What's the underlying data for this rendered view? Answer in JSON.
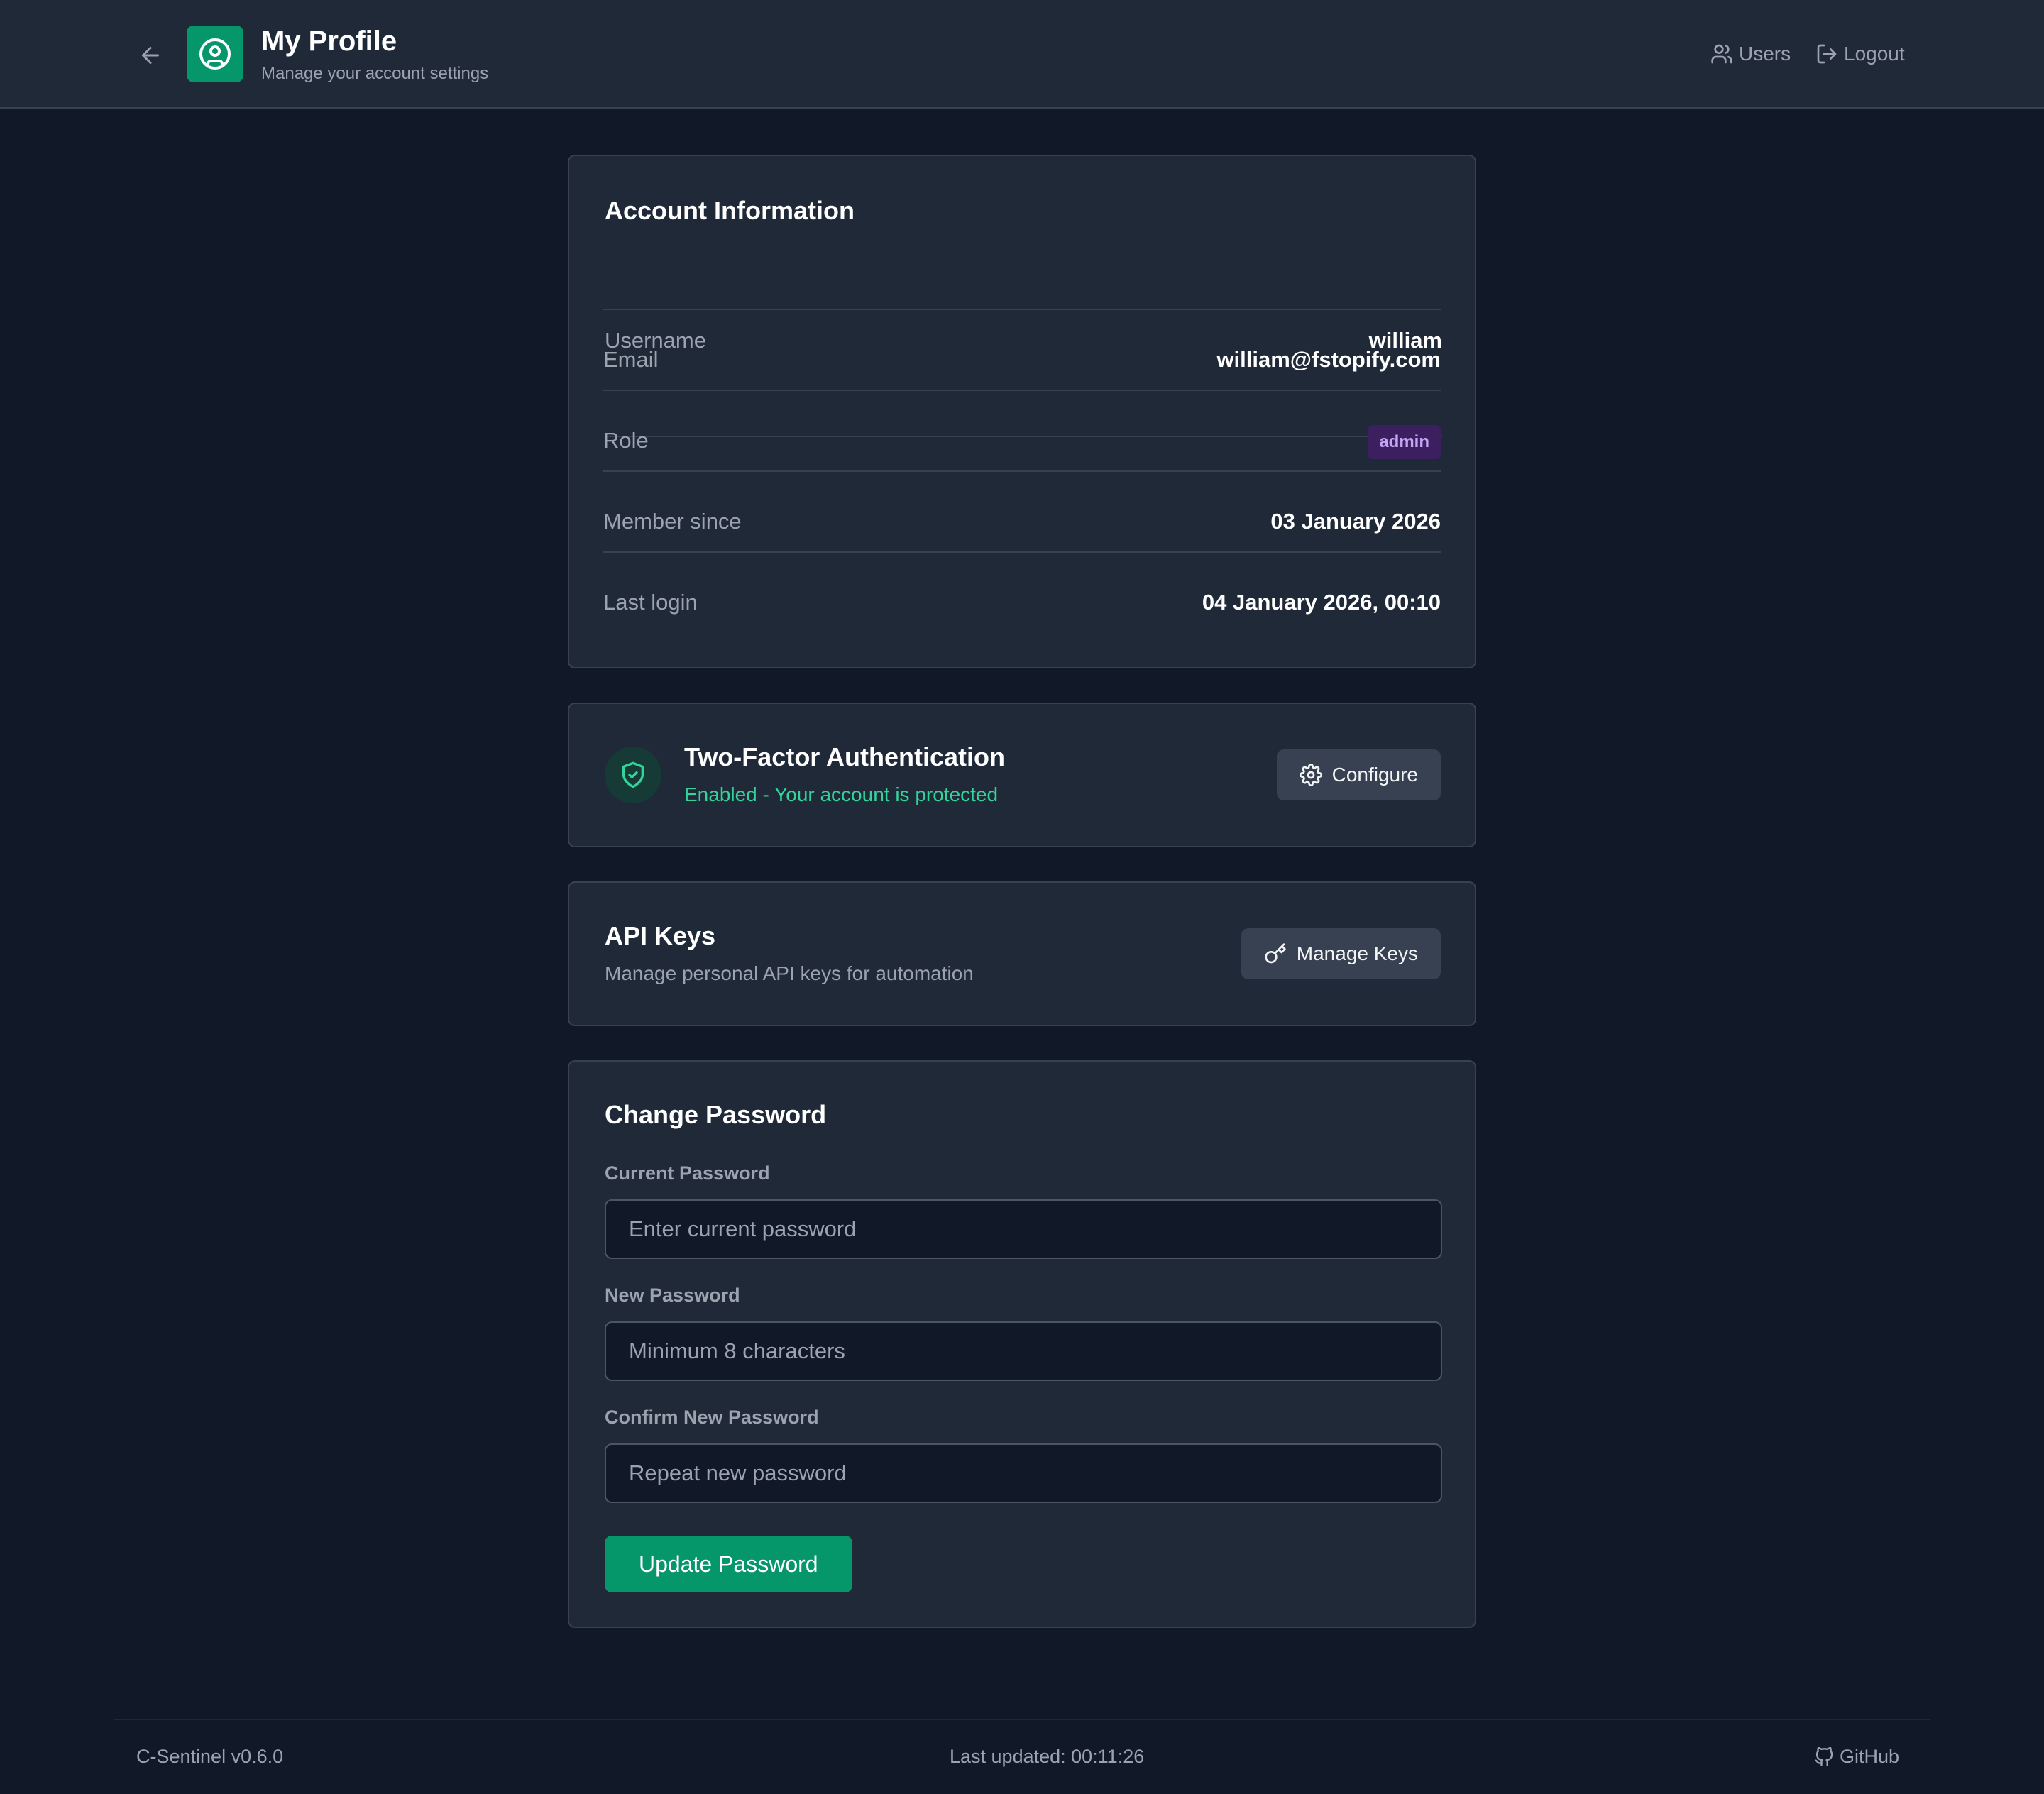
{
  "header": {
    "title": "My Profile",
    "subtitle": "Manage your account settings",
    "nav": {
      "users_label": "Users",
      "logout_label": "Logout"
    }
  },
  "account": {
    "title": "Account Information",
    "rows": [
      {
        "label": "Username",
        "value": "william"
      },
      {
        "label": "Email",
        "value": "william@fstopify.com"
      },
      {
        "label": "Role",
        "value": "admin"
      },
      {
        "label": "Member since",
        "value": "03 January 2026"
      },
      {
        "label": "Last login",
        "value": "04 January 2026, 00:10"
      }
    ]
  },
  "two_factor": {
    "title": "Two-Factor Authentication",
    "status": "Enabled - Your account is protected",
    "configure_label": "Configure"
  },
  "api_keys": {
    "title": "API Keys",
    "description": "Manage personal API keys for automation",
    "manage_label": "Manage Keys"
  },
  "change_password": {
    "title": "Change Password",
    "current_label": "Current Password",
    "current_placeholder": "Enter current password",
    "new_label": "New Password",
    "new_placeholder": "Minimum 8 characters",
    "confirm_label": "Confirm New Password",
    "confirm_placeholder": "Repeat new password",
    "submit_label": "Update Password"
  },
  "footer": {
    "version": "C-Sentinel v0.6.0",
    "last_updated": "Last updated: 00:11:26",
    "github_label": "GitHub"
  },
  "colors": {
    "accent": "#059669",
    "success_text": "#34d399",
    "role_badge_bg": "#3b1f5e",
    "role_badge_text": "#c4a5f5"
  },
  "icons": {
    "back": "arrow-left-icon",
    "logo": "user-circle-icon",
    "users": "users-icon",
    "logout": "logout-icon",
    "shield": "shield-check-icon",
    "configure": "gear-icon",
    "key": "key-icon",
    "github": "github-icon"
  }
}
